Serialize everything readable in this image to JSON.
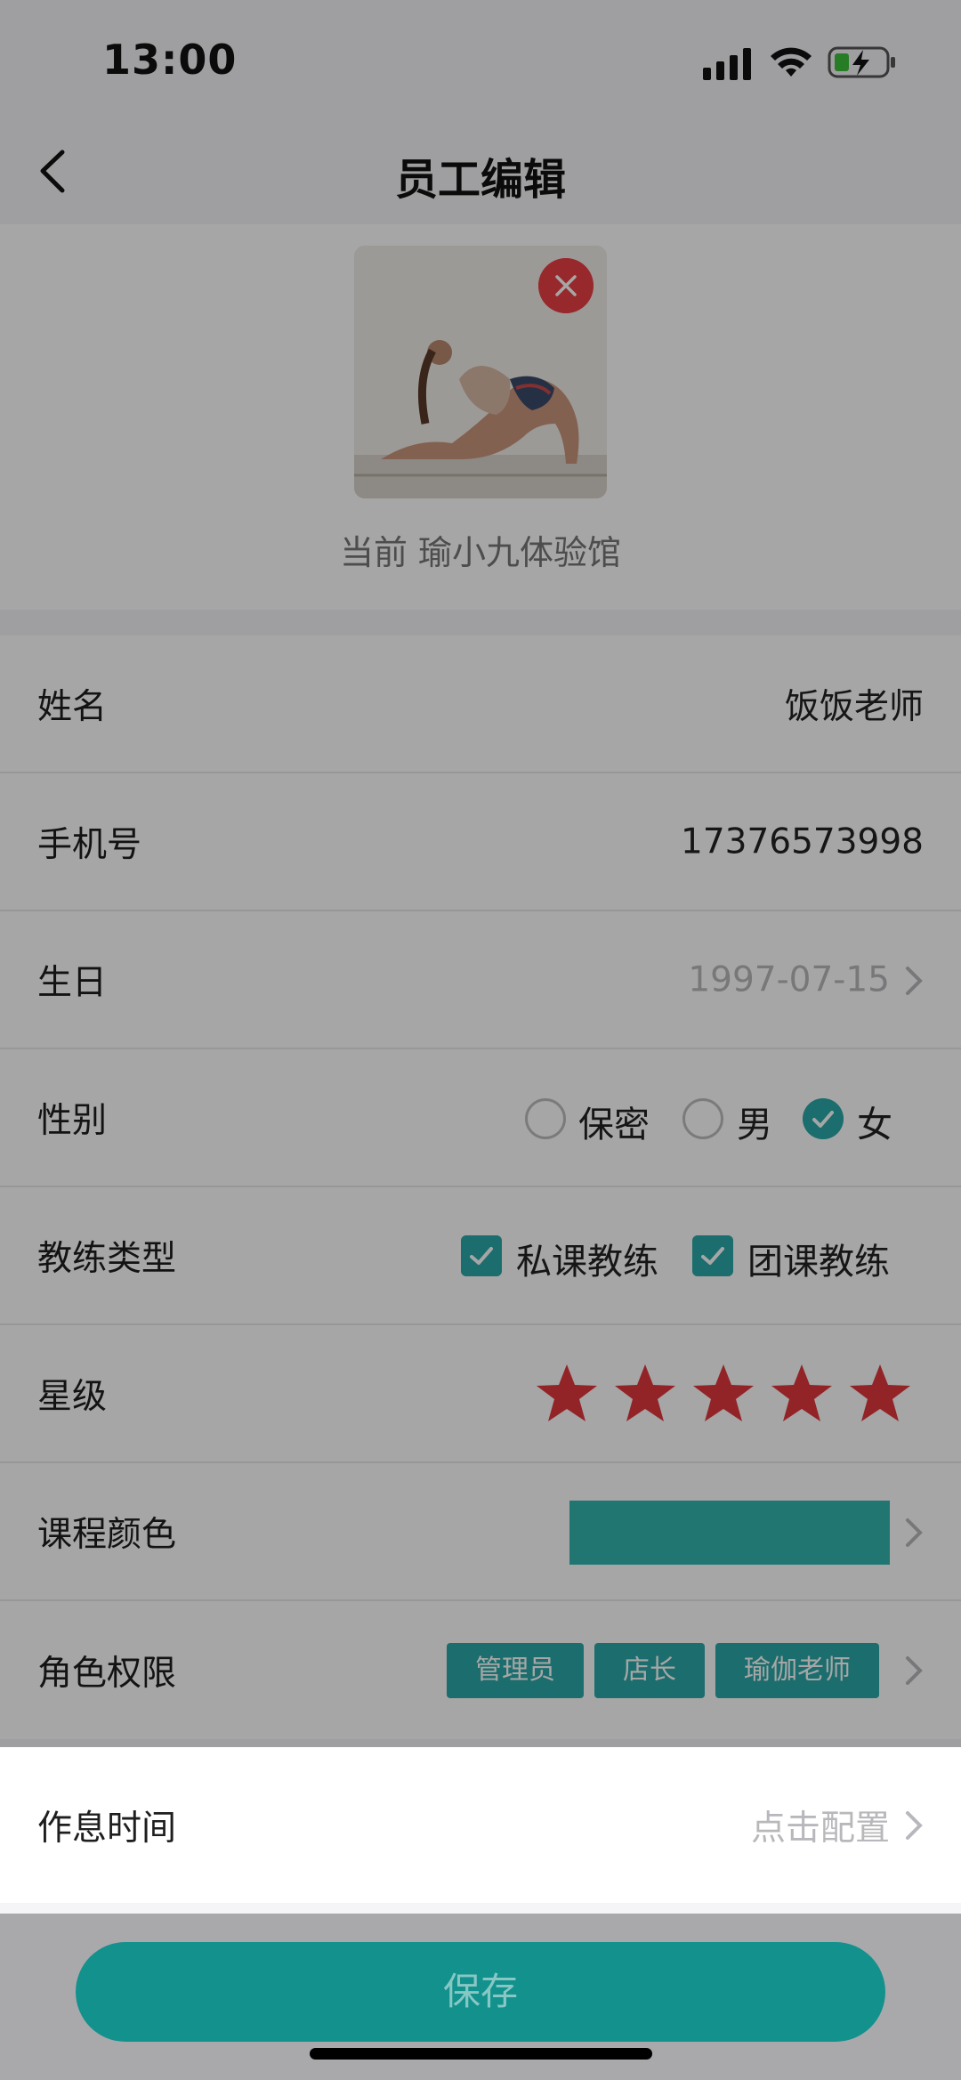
{
  "status_bar": {
    "time": "13:00"
  },
  "nav": {
    "title": "员工编辑"
  },
  "header": {
    "shop_prefix": "当前",
    "shop_name": "瑜小九体验馆"
  },
  "form": {
    "name": {
      "label": "姓名",
      "value": "饭饭老师"
    },
    "phone": {
      "label": "手机号",
      "value": "17376573998"
    },
    "birthday": {
      "label": "生日",
      "value": "1997-07-15"
    },
    "gender": {
      "label": "性别",
      "options": [
        "保密",
        "男",
        "女"
      ],
      "selected": "女"
    },
    "coach_type": {
      "label": "教练类型",
      "options": [
        "私课教练",
        "团课教练"
      ],
      "checked": [
        "私课教练",
        "团课教练"
      ]
    },
    "star_level": {
      "label": "星级",
      "rating": 5,
      "max": 5
    },
    "course_color": {
      "label": "课程颜色",
      "color": "#33b5b0"
    },
    "roles": {
      "label": "角色权限",
      "tags": [
        "管理员",
        "店长",
        "瑜伽老师"
      ]
    },
    "rest_time": {
      "label": "作息时间",
      "value": "点击配置"
    }
  },
  "footer": {
    "save_label": "保存"
  },
  "colors": {
    "accent": "#2ba8a8",
    "star": "#e0383e",
    "remove": "#e84045",
    "save": "#13918d"
  }
}
